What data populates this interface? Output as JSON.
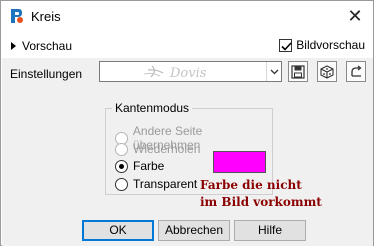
{
  "window": {
    "title": "Kreis",
    "close_glyph": "✕"
  },
  "preview": {
    "label": "Vorschau",
    "image_preview_label": "Bildvorschau",
    "image_preview_checked": true
  },
  "settings": {
    "label": "Einstellungen",
    "preset_value": "",
    "tools": [
      "save-preset-icon",
      "randomize-icon",
      "reset-icon"
    ]
  },
  "edge_mode": {
    "title": "Kantenmodus",
    "options": [
      {
        "label": "Andere Seite übernehmen",
        "selected": false,
        "enabled": false
      },
      {
        "label": "Wiederholen",
        "selected": false,
        "enabled": false
      },
      {
        "label": "Farbe",
        "selected": true,
        "enabled": true
      },
      {
        "label": "Transparent",
        "selected": false,
        "enabled": true
      }
    ],
    "color": "#ff00ff"
  },
  "annotation": {
    "line1": "Farbe die nicht",
    "line2": "im Bild vorkommt",
    "color": "#8b0000"
  },
  "buttons": {
    "ok": "OK",
    "cancel": "Abbrechen",
    "help": "Hilfe"
  }
}
